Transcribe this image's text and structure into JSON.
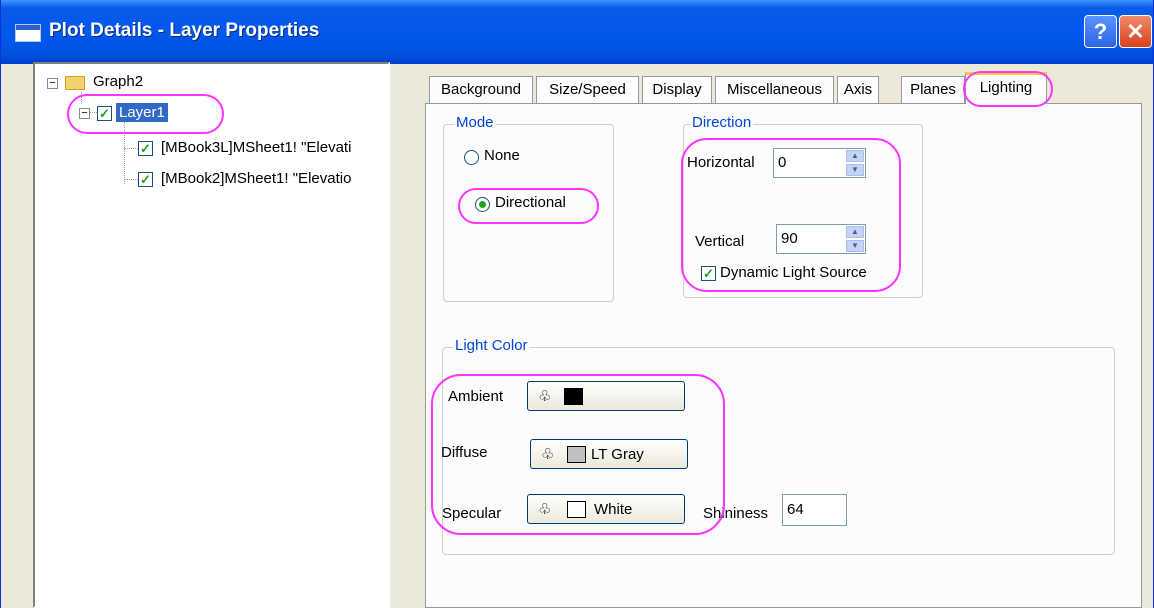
{
  "window": {
    "title": "Plot Details - Layer Properties"
  },
  "tree": {
    "root": "Graph2",
    "layer": "Layer1",
    "plots": [
      "[MBook3L]MSheet1! \"Elevati",
      "[MBook2]MSheet1! \"Elevatio"
    ]
  },
  "tabs": [
    "Background",
    "Size/Speed",
    "Display",
    "Miscellaneous",
    "Axis",
    "Planes",
    "Lighting"
  ],
  "active_tab": "Lighting",
  "mode": {
    "legend": "Mode",
    "none_label": "None",
    "directional_label": "Directional",
    "selected": "Directional"
  },
  "direction": {
    "legend": "Direction",
    "horizontal_label": "Horizontal",
    "horizontal_value": "0",
    "vertical_label": "Vertical",
    "vertical_value": "90",
    "dynamic_label": "Dynamic Light Source",
    "dynamic_checked": true
  },
  "light_color": {
    "legend": "Light Color",
    "ambient_label": "Ambient",
    "ambient_color": "#000000",
    "ambient_text": "",
    "diffuse_label": "Diffuse",
    "diffuse_color": "#c0c0c0",
    "diffuse_text": "LT Gray",
    "specular_label": "Specular",
    "specular_color": "#ffffff",
    "specular_text": "White",
    "shininess_label": "Shininess",
    "shininess_value": "64"
  },
  "colors": {
    "highlight": "#ff33ff",
    "title_bar": "#0058ee",
    "group_legend": "#0046d5",
    "selection": "#316ac5"
  }
}
